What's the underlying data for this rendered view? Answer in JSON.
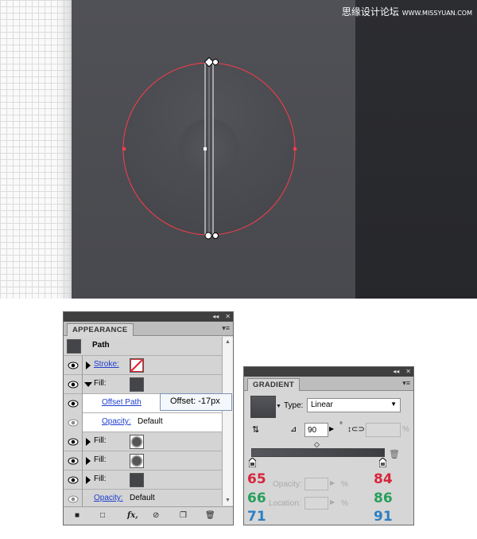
{
  "watermark": {
    "text": "思缘设计论坛",
    "url_text": "WWW.MISSYUAN.COM"
  },
  "appearance_panel": {
    "tab_title": "APPEARANCE",
    "header_arrows": "◂◂",
    "close_glyph": "✕",
    "menu_glyph": "▾≡",
    "object_label": "Path",
    "rows": [
      {
        "label": "Stroke:",
        "type": "stroke"
      },
      {
        "label": "Fill:",
        "type": "fill-dark-expanded"
      },
      {
        "label": "Offset Path",
        "type": "effect"
      },
      {
        "label": "Opacity:",
        "value": "Default",
        "type": "opacity"
      },
      {
        "label": "Fill:",
        "type": "fill-checker"
      },
      {
        "label": "Fill:",
        "type": "fill-checker"
      },
      {
        "label": "Fill:",
        "type": "fill-dark"
      },
      {
        "label": "Opacity:",
        "value": "Default",
        "type": "opacity"
      }
    ],
    "footer_icons": [
      "square-icon",
      "new-stroke-icon",
      "fx-icon",
      "clear-icon",
      "duplicate-icon",
      "trash-icon"
    ],
    "fx_label": "fx,"
  },
  "tooltip": {
    "text": "Offset: -17px"
  },
  "gradient_panel": {
    "tab_title": "GRADIENT",
    "header_arrows": "◂◂",
    "close_glyph": "✕",
    "menu_glyph": "▾≡",
    "type_label": "Type:",
    "type_value": "Linear",
    "angle_value": "90",
    "degree_symbol": "°",
    "percent_symbol": "%",
    "opacity_label": "Opacity:",
    "location_label": "Location:",
    "stop_left_rgb": [
      "65",
      "66",
      "71"
    ],
    "stop_right_rgb": [
      "84",
      "86",
      "91"
    ],
    "colors": {
      "red": "#d7263d",
      "green": "#27a05a",
      "blue": "#2e7fc1"
    }
  }
}
